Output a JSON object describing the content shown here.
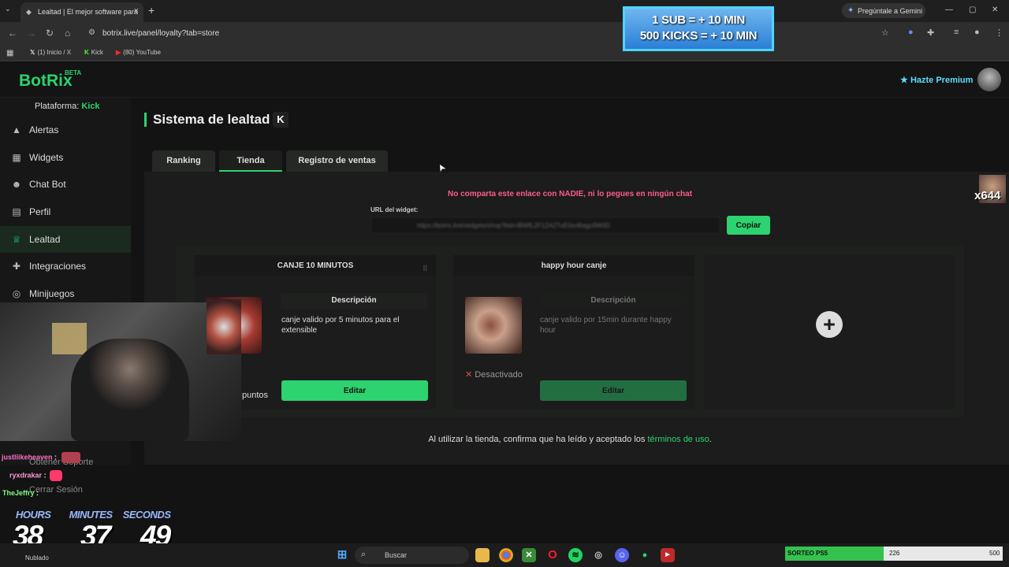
{
  "browser": {
    "tab_title": "Lealtad | El mejor software para",
    "url": "botrix.live/panel/loyalty?tab=store",
    "gemini_label": "Pregúntale a Gemini",
    "bookmarks": [
      "(1) Inicio / X",
      "Kick",
      "(80) YouTube"
    ]
  },
  "overlay_banner": {
    "line1": "1 SUB = + 10 MIN",
    "line2": "500 KICKS = + 10 MIN"
  },
  "header": {
    "logo": "BotRix",
    "beta": "BETA",
    "premium": "Hazte Premium"
  },
  "sidebar": {
    "platform_label": "Plataforma:",
    "platform_value": "Kick",
    "items": [
      {
        "label": "Alertas"
      },
      {
        "label": "Widgets"
      },
      {
        "label": "Chat Bot"
      },
      {
        "label": "Perfil"
      },
      {
        "label": "Lealtad"
      },
      {
        "label": "Integraciones"
      },
      {
        "label": "Minijuegos"
      }
    ],
    "support": "Obtener Soporte",
    "logout": "Cerrar Sesión"
  },
  "main": {
    "title": "Sistema de lealtad",
    "platform_badge": "K",
    "tabs": [
      {
        "label": "Ranking"
      },
      {
        "label": "Tienda"
      },
      {
        "label": "Registro de ventas"
      }
    ],
    "warning": "No comparta este enlace con NADIE, ni lo pegues en ningún chat",
    "url_label": "URL del widget:",
    "url_value": "https://botrix.live/widgets/shop?bid=IBWfL2F1ZA2TuE0snBagu9W0D",
    "copy_button": "Copiar",
    "cards": [
      {
        "title": "CANJE 10 MINUTOS",
        "desc_header": "Descripción",
        "desc": "canje valido por 5 minutos para el extensible",
        "points_label": "puntos",
        "edit_button": "Editar"
      },
      {
        "title": "happy hour canje",
        "desc_header": "Descripción",
        "desc": "canje valido por 15min durante happy hour",
        "status": "Desactivado",
        "edit_button": "Editar"
      }
    ],
    "terms_prefix": "Al utilizar la tienda, confirma que ha leído y aceptado los",
    "terms_link": "términos de uso",
    "terms_suffix": "."
  },
  "stream_overlay": {
    "chat": [
      {
        "user": "justliikeheaven",
        "sep": ":"
      },
      {
        "user": "ryxdrakar",
        "sep": ":"
      },
      {
        "user": "TheJeffry",
        "sep": ":"
      }
    ],
    "timer_labels": {
      "hours": "HOURS",
      "minutes": "MINUTES",
      "seconds": "SECONDS"
    },
    "timer": {
      "hours": "38",
      "minutes": "37",
      "seconds": "49"
    },
    "viewer_count": "x644",
    "weather": "Nublado"
  },
  "taskbar": {
    "search_placeholder": "Buscar",
    "progress_name": "SORTEO PS5",
    "progress_value": "226",
    "progress_max": "500",
    "progress_fraction": 0.452
  },
  "colors": {
    "accent": "#2dd36f",
    "warning": "#ff5c8a",
    "premium": "#5fdcff"
  }
}
